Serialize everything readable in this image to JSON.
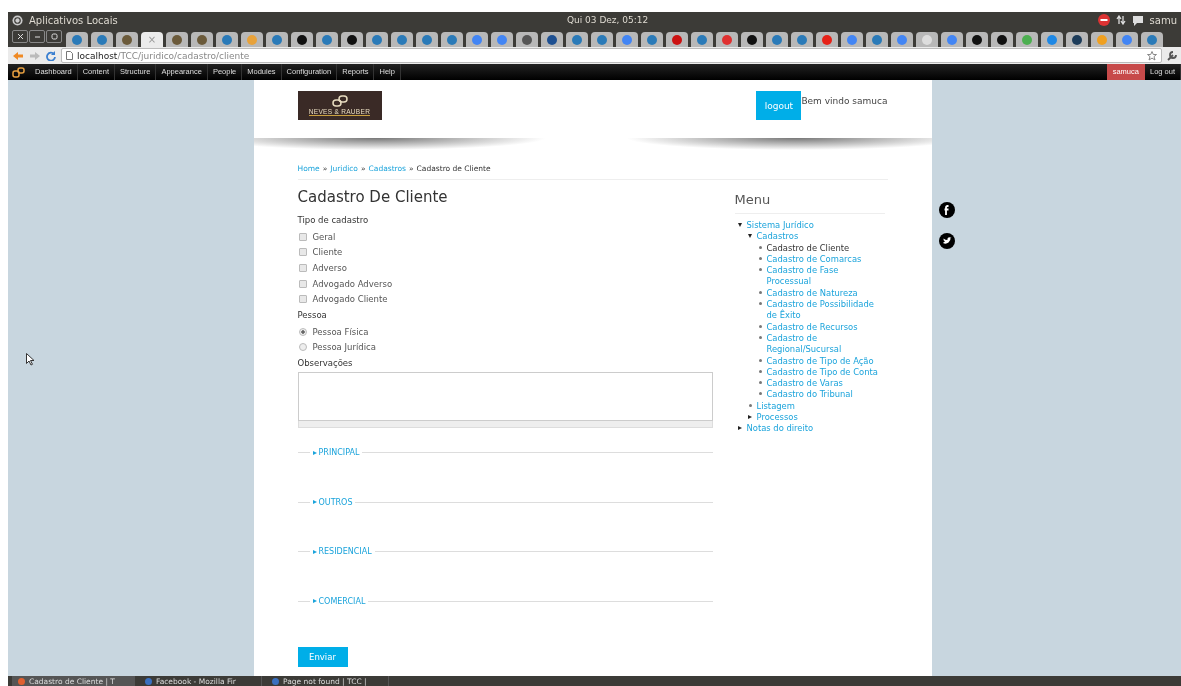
{
  "top_panel": {
    "title": "Aplicativos Locais",
    "clock": "Qui 03 Dez, 05:12",
    "user": "samu"
  },
  "browser": {
    "close_glyph": "×",
    "tabs": [
      {
        "selected": false,
        "color": "#2a7ab8"
      },
      {
        "selected": false,
        "color": "#2a7ab8"
      },
      {
        "selected": false,
        "color": "#6b5a3a"
      },
      {
        "selected": true
      },
      {
        "selected": false,
        "color": "#6b5a3a"
      },
      {
        "selected": false,
        "color": "#6b5a3a"
      },
      {
        "selected": false,
        "color": "#2a7ab8"
      },
      {
        "selected": false,
        "color": "#e8a23a"
      },
      {
        "selected": false,
        "color": "#2a7ab8"
      },
      {
        "selected": false,
        "color": "#111111"
      },
      {
        "selected": false,
        "color": "#2a7ab8"
      },
      {
        "selected": false,
        "color": "#111111"
      },
      {
        "selected": false,
        "color": "#2a7ab8"
      },
      {
        "selected": false,
        "color": "#2a7ab8"
      },
      {
        "selected": false,
        "color": "#2a7ab8"
      },
      {
        "selected": false,
        "color": "#2a7ab8"
      },
      {
        "selected": false,
        "color": "#4285f4"
      },
      {
        "selected": false,
        "color": "#4285f4"
      },
      {
        "selected": false,
        "color": "#555555"
      },
      {
        "selected": false,
        "color": "#1d4f91"
      },
      {
        "selected": false,
        "color": "#2a7ab8"
      },
      {
        "selected": false,
        "color": "#2a7ab8"
      },
      {
        "selected": false,
        "color": "#4285f4"
      },
      {
        "selected": false,
        "color": "#2a7ab8"
      },
      {
        "selected": false,
        "color": "#cc1111"
      },
      {
        "selected": false,
        "color": "#2a7ab8"
      },
      {
        "selected": false,
        "color": "#e03030"
      },
      {
        "selected": false,
        "color": "#111111"
      },
      {
        "selected": false,
        "color": "#2a7ab8"
      },
      {
        "selected": false,
        "color": "#2a7ab8"
      },
      {
        "selected": false,
        "color": "#e62117"
      },
      {
        "selected": false,
        "color": "#4285f4"
      },
      {
        "selected": false,
        "color": "#2a7ab8"
      },
      {
        "selected": false,
        "color": "#4285f4"
      },
      {
        "selected": false,
        "color": "#dddddd"
      },
      {
        "selected": false,
        "color": "#4285f4"
      },
      {
        "selected": false,
        "color": "#111111"
      },
      {
        "selected": false,
        "color": "#111111"
      },
      {
        "selected": false,
        "color": "#4caf50"
      },
      {
        "selected": false,
        "color": "#1e88e5"
      },
      {
        "selected": false,
        "color": "#1d3c5a"
      },
      {
        "selected": false,
        "color": "#f0a020"
      },
      {
        "selected": false,
        "color": "#4285f4"
      },
      {
        "selected": false,
        "color": "#2a7ab8"
      }
    ],
    "url_host": "localhost",
    "url_path": "/TCC/juridico/cadastro/cliente"
  },
  "admin_bar": {
    "items": [
      "Dashboard",
      "Content",
      "Structure",
      "Appearance",
      "People",
      "Modules",
      "Configuration",
      "Reports",
      "Help"
    ],
    "user": "samuca",
    "logout": "Log out"
  },
  "header": {
    "logo_text": "NEVES & RAUBER",
    "logout": "logout",
    "welcome": "Bem vindo samuca"
  },
  "breadcrumb": [
    {
      "label": "Home",
      "link": true,
      "sep": "»"
    },
    {
      "label": "Juridico",
      "link": true,
      "sep": "»"
    },
    {
      "label": "Cadastros",
      "link": true,
      "sep": "»"
    },
    {
      "label": "Cadastro de Cliente",
      "link": false
    }
  ],
  "form": {
    "title": "Cadastro De Cliente",
    "tipo_label": "Tipo de cadastro",
    "tipos": [
      {
        "label": "Geral",
        "checked": false
      },
      {
        "label": "Cliente",
        "checked": false
      },
      {
        "label": "Adverso",
        "checked": false
      },
      {
        "label": "Advogado Adverso",
        "checked": false
      },
      {
        "label": "Advogado Cliente",
        "checked": false
      }
    ],
    "pessoa_label": "Pessoa",
    "pessoas": [
      {
        "label": "Pessoa Física",
        "selected": true
      },
      {
        "label": "Pessoa Jurídica",
        "selected": false
      }
    ],
    "obs_label": "Observações",
    "sections": [
      {
        "label": "PRINCIPAL",
        "expanded": false
      },
      {
        "label": "OUTROS",
        "expanded": false
      },
      {
        "label": "RESIDENCIAL",
        "expanded": false
      },
      {
        "label": "COMERCIAL",
        "expanded": false
      }
    ],
    "submit": "Enviar"
  },
  "menu": {
    "title": "Menu",
    "items": [
      {
        "label": "Sistema Jurídico",
        "kind": "expanded",
        "active": false,
        "children": [
          {
            "label": "Cadastros",
            "kind": "expanded",
            "active": false,
            "children": [
              {
                "label": "Cadastro de Cliente",
                "kind": "leaf",
                "active": true
              },
              {
                "label": "Cadastro de Comarcas",
                "kind": "leaf",
                "active": false
              },
              {
                "label": "Cadastro de Fase Processual",
                "kind": "leaf",
                "active": false
              },
              {
                "label": "Cadastro de Natureza",
                "kind": "leaf",
                "active": false
              },
              {
                "label": "Cadastro de Possibilidade de Êxito",
                "kind": "leaf",
                "active": false
              },
              {
                "label": "Cadastro de Recursos",
                "kind": "leaf",
                "active": false
              },
              {
                "label": "Cadastro de Regional/Sucursal",
                "kind": "leaf",
                "active": false
              },
              {
                "label": "Cadastro de Tipo de Ação",
                "kind": "leaf",
                "active": false
              },
              {
                "label": "Cadastro de Tipo de Conta",
                "kind": "leaf",
                "active": false
              },
              {
                "label": "Cadastro de Varas",
                "kind": "leaf",
                "active": false
              },
              {
                "label": "Cadastro do Tribunal",
                "kind": "leaf",
                "active": false
              }
            ]
          },
          {
            "label": "Listagem",
            "kind": "leaf",
            "active": false
          },
          {
            "label": "Processos",
            "kind": "collapsed",
            "active": false
          }
        ]
      },
      {
        "label": "Notas do direito",
        "kind": "collapsed",
        "active": false
      }
    ]
  },
  "taskbar": [
    {
      "label": "Cadastro de Cliente | T",
      "selected": true
    },
    {
      "label": "Facebook - Mozilla Fir",
      "selected": false
    },
    {
      "label": "Page not found | TCC |",
      "selected": false
    }
  ]
}
